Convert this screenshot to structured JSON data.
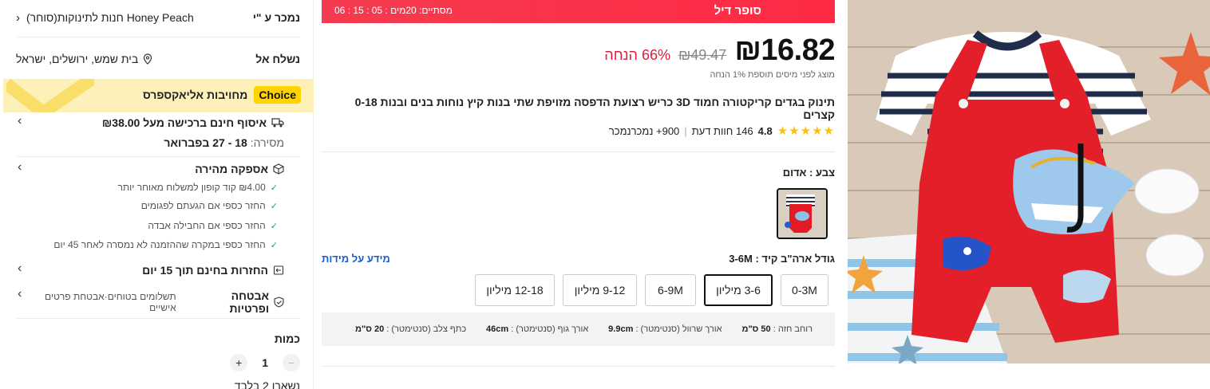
{
  "seller": {
    "label": "נמכר ע \"י",
    "name": "Honey Peach חנות לתינוקות(סוחר)"
  },
  "shipping": {
    "label": "נשלח אל",
    "location": "בית שמש, ירושלים, ישראל"
  },
  "choice": {
    "badge": "Choice",
    "text": "מחויבות אליאקספרס"
  },
  "free_pickup": {
    "title": "איסוף חינם ברכישה מעל ₪38.00",
    "delivery_label": "מסירה:",
    "delivery_dates": "18 - 27 בפברואר"
  },
  "fast_delivery": {
    "title": "אספקה מהירה",
    "items": [
      "₪4.00 קוד קופון למשלוח מאוחר יותר",
      "החזר כספי אם הגעתם לפגומים",
      "החזר כספי אם החבילה אבדה",
      "החזר כספי במקרה שההזמנה לא נמסרה לאחר 45 יום"
    ]
  },
  "returns": {
    "title": "החזרות בחינם תוך 15 יום"
  },
  "security": {
    "title": "אבטחה ופרטיות",
    "note": "תשלומים בטוחים·אבטחת פרטים אישיים"
  },
  "quantity": {
    "label": "כמות",
    "value": "1",
    "minus": "−",
    "plus": "+",
    "note": "נשארו 2 בלבד"
  },
  "deal": {
    "title": "סופר דיל",
    "countdown": "מסתיים: 20מים : 05 : 15 : 06"
  },
  "price": {
    "current": "₪16.82",
    "original": "₪49.47",
    "discount": "66% הנחה",
    "tax_note": "מוצג לפני מיסים תוספת 1% הנחה"
  },
  "product": {
    "title": "תינוק בגדים קריקטורה חמוד 3D כריש רצועת הדפסה מזויפת שתי בנות קיץ נוחות בנים ובנות 0-18 קצרים",
    "rating": "4.8",
    "stars": "★★★★★",
    "reviews": "146 חוות דעת",
    "sold": "900+ נמכרנמכר",
    "separator": "|"
  },
  "color": {
    "label": "צבע : אדום"
  },
  "size": {
    "label": "גודל ארה\"ב קיד : 3-6M",
    "info_link": "מידע על מידות",
    "options": [
      "0-3M",
      "3-6 מיליון",
      "6-9M",
      "9-12 מיליון",
      "12-18 מיליון"
    ],
    "selected": "3-6 מיליון"
  },
  "size_info": {
    "chest": "רוחב חזה :",
    "chest_val": "50 ס\"מ",
    "sleeve": "אורך שרוול (סנטימטר) :",
    "sleeve_val": "9.9cm",
    "body": "אורך גוף (סנטימטר) :",
    "body_val": "46cm",
    "shoulder": "כתף צלב (סנטימטר) :",
    "shoulder_val": "20 ס\"מ"
  },
  "colors": {
    "deal_red": "#ff2a44",
    "discount_red": "#e21b3c",
    "choice_yellow": "#ffd400",
    "star": "#fac014",
    "link_blue": "#1a5bd6"
  }
}
